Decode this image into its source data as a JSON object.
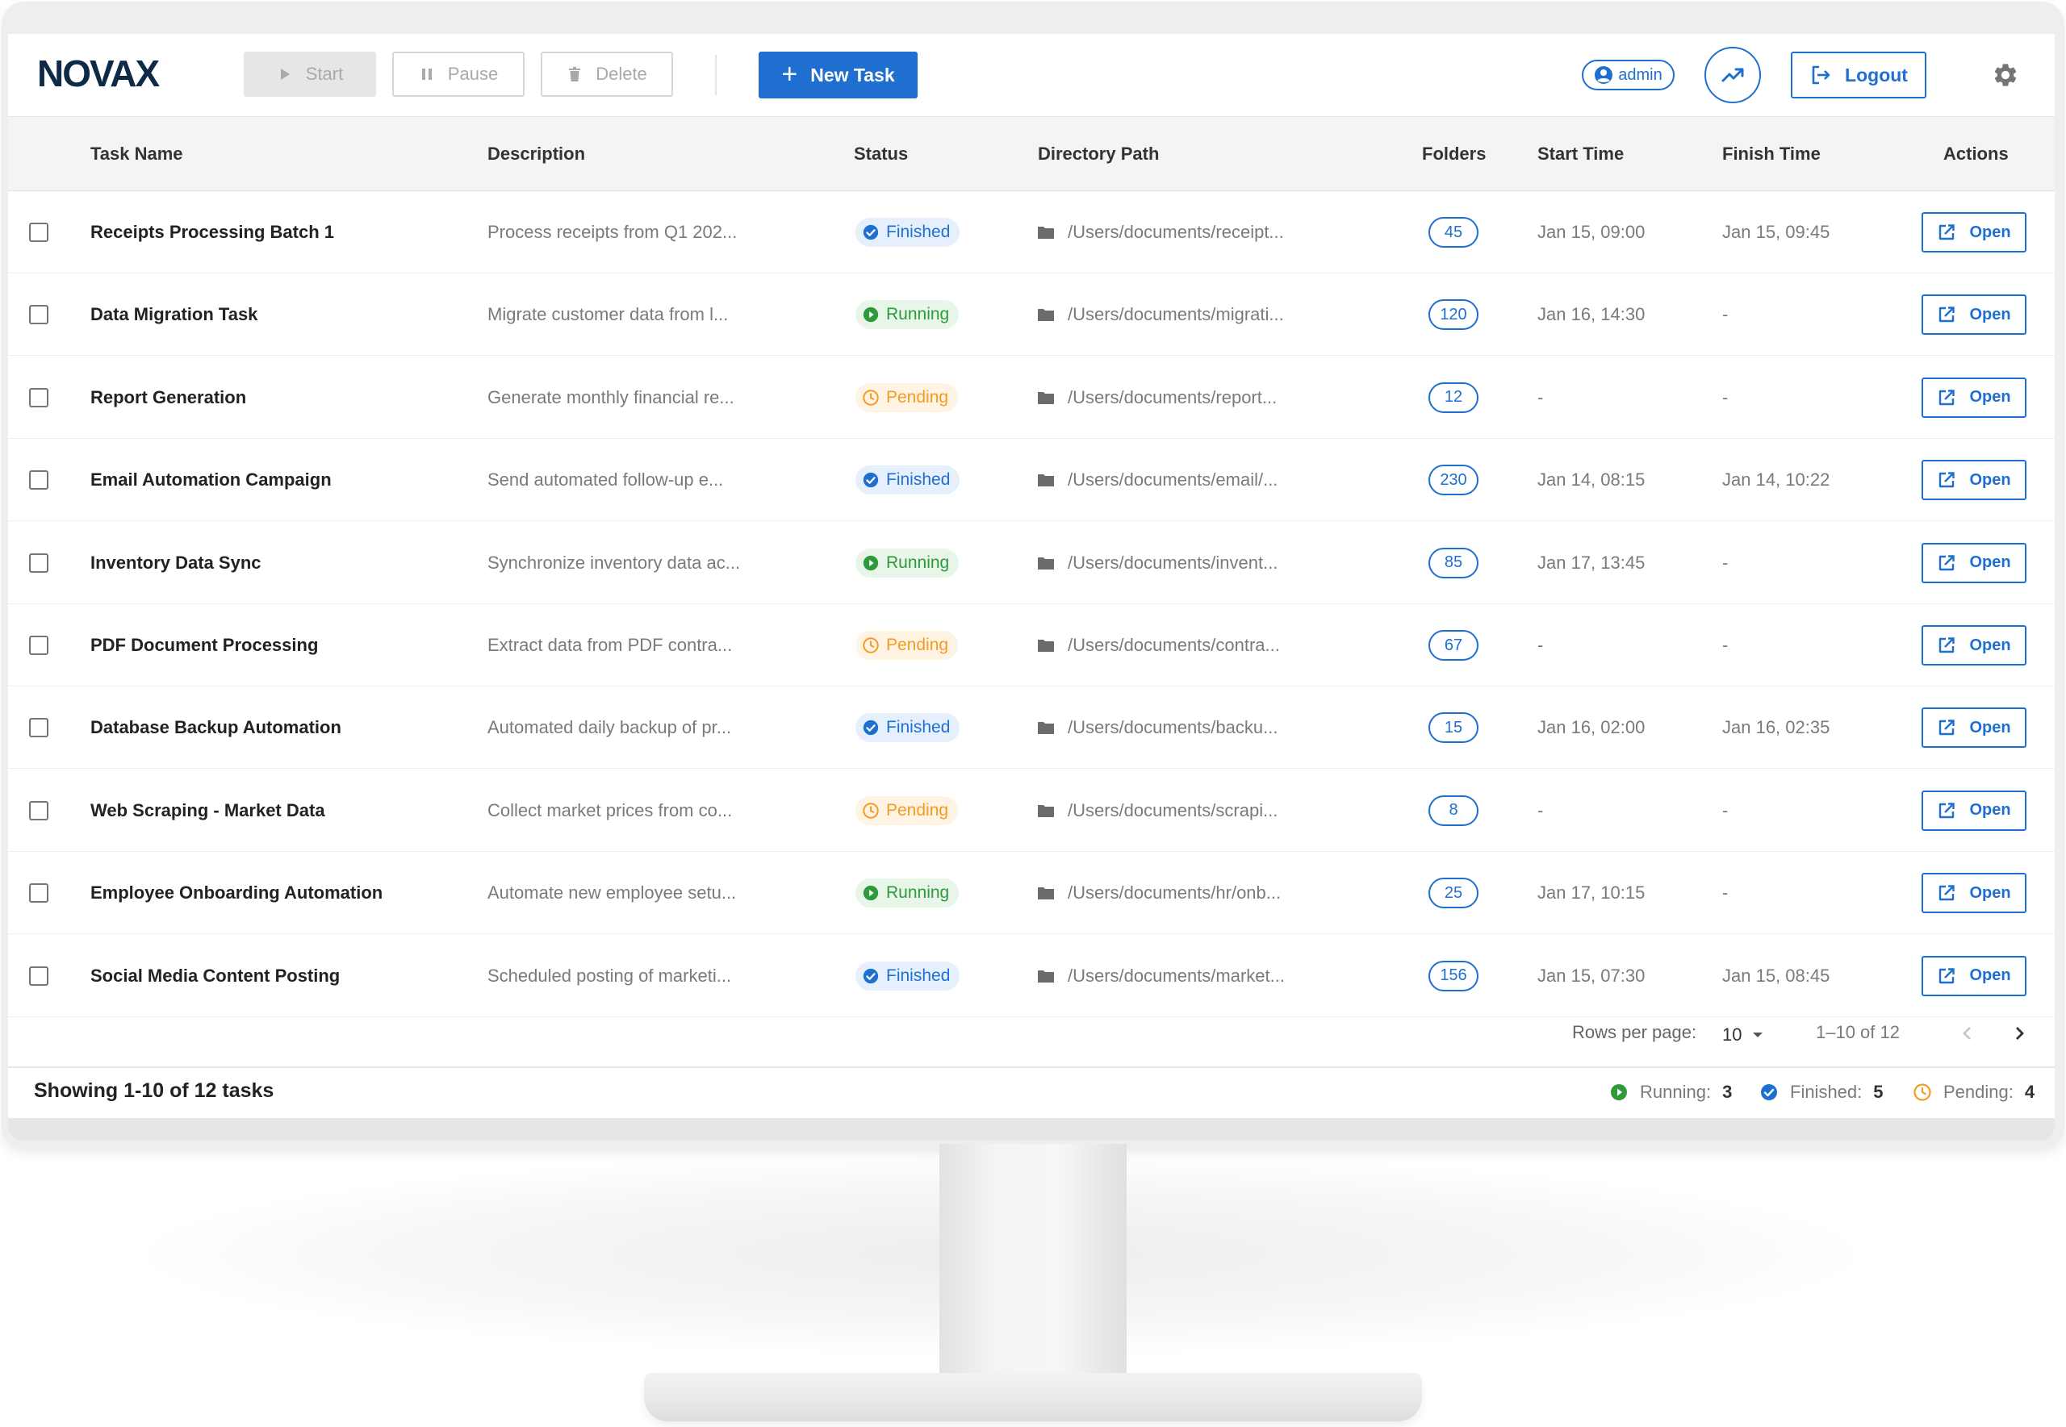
{
  "app": {
    "logo": "NOVAX"
  },
  "toolbar": {
    "start_label": "Start",
    "pause_label": "Pause",
    "delete_label": "Delete",
    "new_task_label": "New Task",
    "user_label": "admin",
    "logout_label": "Logout"
  },
  "table": {
    "columns": [
      "Task Name",
      "Description",
      "Status",
      "Directory Path",
      "Folders",
      "Start Time",
      "Finish Time",
      "Actions"
    ],
    "open_label": "Open",
    "rows": [
      {
        "name": "Receipts Processing Batch 1",
        "description": "Process receipts from Q1 202...",
        "status": "Finished",
        "path": "/Users/documents/receipt...",
        "folders": "45",
        "start": "Jan 15, 09:00",
        "finish": "Jan 15, 09:45"
      },
      {
        "name": "Data Migration Task",
        "description": "Migrate customer data from l...",
        "status": "Running",
        "path": "/Users/documents/migrati...",
        "folders": "120",
        "start": "Jan 16, 14:30",
        "finish": "-"
      },
      {
        "name": "Report Generation",
        "description": "Generate monthly financial re...",
        "status": "Pending",
        "path": "/Users/documents/report...",
        "folders": "12",
        "start": "-",
        "finish": "-"
      },
      {
        "name": "Email Automation Campaign",
        "description": "Send automated follow-up e...",
        "status": "Finished",
        "path": "/Users/documents/email/...",
        "folders": "230",
        "start": "Jan 14, 08:15",
        "finish": "Jan 14, 10:22"
      },
      {
        "name": "Inventory Data Sync",
        "description": "Synchronize inventory data ac...",
        "status": "Running",
        "path": "/Users/documents/invent...",
        "folders": "85",
        "start": "Jan 17, 13:45",
        "finish": "-"
      },
      {
        "name": "PDF Document Processing",
        "description": "Extract data from PDF contra...",
        "status": "Pending",
        "path": "/Users/documents/contra...",
        "folders": "67",
        "start": "-",
        "finish": "-"
      },
      {
        "name": "Database Backup Automation",
        "description": "Automated daily backup of pr...",
        "status": "Finished",
        "path": "/Users/documents/backu...",
        "folders": "15",
        "start": "Jan 16, 02:00",
        "finish": "Jan 16, 02:35"
      },
      {
        "name": "Web Scraping - Market Data",
        "description": "Collect market prices from co...",
        "status": "Pending",
        "path": "/Users/documents/scrapi...",
        "folders": "8",
        "start": "-",
        "finish": "-"
      },
      {
        "name": "Employee Onboarding Automation",
        "description": "Automate new employee setu...",
        "status": "Running",
        "path": "/Users/documents/hr/onb...",
        "folders": "25",
        "start": "Jan 17, 10:15",
        "finish": "-"
      },
      {
        "name": "Social Media Content Posting",
        "description": "Scheduled posting of marketi...",
        "status": "Finished",
        "path": "/Users/documents/market...",
        "folders": "156",
        "start": "Jan 15, 07:30",
        "finish": "Jan 15, 08:45"
      }
    ]
  },
  "pagination": {
    "rows_per_page_label": "Rows per page:",
    "rows_per_page_value": "10",
    "range": "1–10 of 12"
  },
  "footer": {
    "showing": "Showing 1-10 of 12 tasks",
    "running_label": "Running:",
    "running_count": "3",
    "finished_label": "Finished:",
    "finished_count": "5",
    "pending_label": "Pending:",
    "pending_count": "4"
  },
  "colors": {
    "accent": "#1f6fd1",
    "finished": "#1f6fd1",
    "running": "#2e9a3a",
    "pending": "#f59a23",
    "logo": "#0e2a47"
  },
  "icons": {
    "start": "play-icon",
    "pause": "pause-icon",
    "delete": "trash-icon",
    "new_task": "plus-icon",
    "user": "account-circle-icon",
    "analytics": "trending-up-icon",
    "logout": "logout-icon",
    "settings": "gear-icon",
    "folder": "folder-icon",
    "open": "open-in-new-icon"
  }
}
